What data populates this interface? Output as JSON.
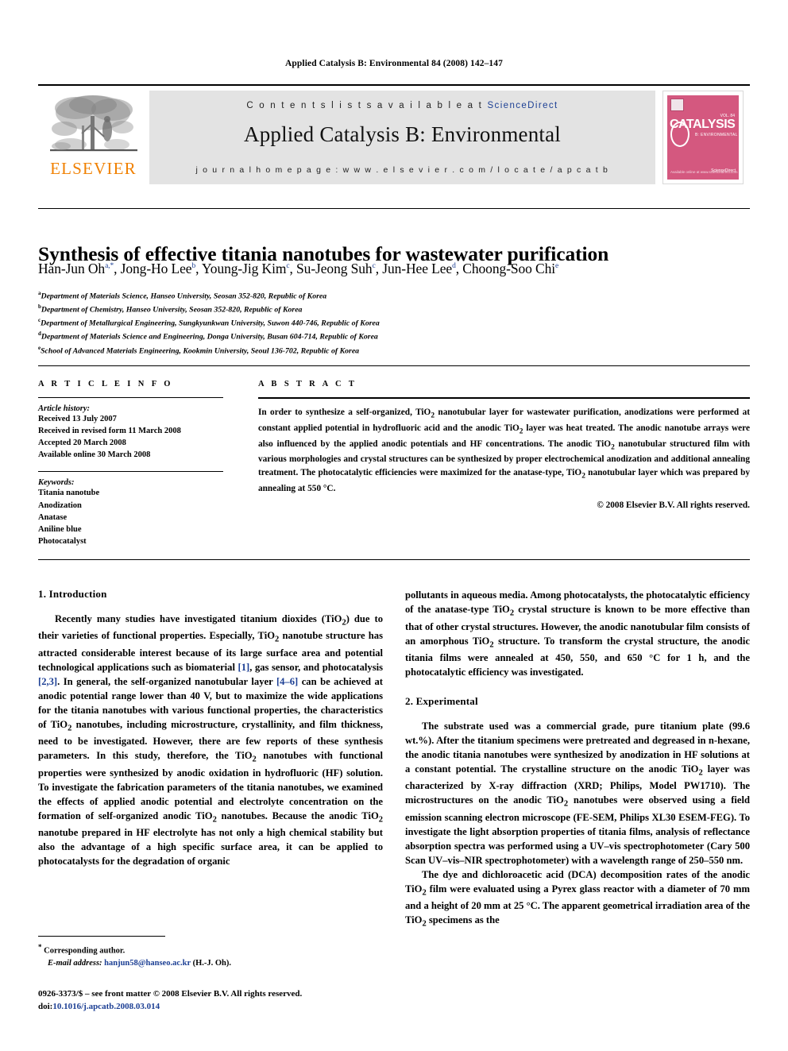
{
  "running_head": "Applied Catalysis B: Environmental 84 (2008) 142–147",
  "masthead": {
    "publisher_name": "ELSEVIER",
    "contents_prefix": "C o n t e n t s   l i s t s   a v a i l a b l e   a t  ",
    "contents_link": "ScienceDirect",
    "journal_name": "Applied Catalysis B: Environmental",
    "homepage": "j o u r n a l   h o m e p a g e :   w w w . e l s e v i e r . c o m / l o c a t e / a p c a t b",
    "cover": {
      "title": "CATALYSIS",
      "subtitle": "B: ENVIRONMENTAL",
      "volume": "VOL. 84",
      "footer_left": "Available online at\nwww.sciencedirect.com",
      "footer_right": "ScienceDirect",
      "bg_color": "#d4587f"
    }
  },
  "article": {
    "title": "Synthesis of effective titania nanotubes for wastewater purification",
    "authors": [
      {
        "name": "Han-Jun Oh",
        "marks": "a,*"
      },
      {
        "name": "Jong-Ho Lee",
        "marks": "b"
      },
      {
        "name": "Young-Jig Kim",
        "marks": "c"
      },
      {
        "name": "Su-Jeong Suh",
        "marks": "c"
      },
      {
        "name": "Jun-Hee Lee",
        "marks": "d"
      },
      {
        "name": "Choong-Soo Chi",
        "marks": "e"
      }
    ],
    "affiliations": [
      {
        "mark": "a",
        "text": "Department of Materials Science, Hanseo University, Seosan 352-820, Republic of Korea"
      },
      {
        "mark": "b",
        "text": "Department of Chemistry, Hanseo University, Seosan 352-820, Republic of Korea"
      },
      {
        "mark": "c",
        "text": "Department of Metallurgical Engineering, Sungkyunkwan University, Suwon 440-746, Republic of Korea"
      },
      {
        "mark": "d",
        "text": "Department of Materials Science and Engineering, Donga University, Busan 604-714, Republic of Korea"
      },
      {
        "mark": "e",
        "text": "School of Advanced Materials Engineering, Kookmin University, Seoul 136-702, Republic of Korea"
      }
    ]
  },
  "article_info": {
    "heading": "A R T I C L E   I N F O",
    "history_heading": "Article history:",
    "history": [
      "Received 13 July 2007",
      "Received in revised form 11 March 2008",
      "Accepted 20 March 2008",
      "Available online 30 March 2008"
    ],
    "keywords_heading": "Keywords:",
    "keywords": [
      "Titania nanotube",
      "Anodization",
      "Anatase",
      "Aniline blue",
      "Photocatalyst"
    ]
  },
  "abstract": {
    "heading": "A B S T R A C T",
    "text": "In order to synthesize a self-organized, TiO2 nanotubular layer for wastewater purification, anodizations were performed at constant applied potential in hydrofluoric acid and the anodic TiO2 layer was heat treated. The anodic nanotube arrays were also influenced by the applied anodic potentials and HF concentrations. The anodic TiO2 nanotubular structured film with various morphologies and crystal structures can be synthesized by proper electrochemical anodization and additional annealing treatment. The photocatalytic efficiencies were maximized for the anatase-type, TiO2 nanotubular layer which was prepared by annealing at 550 °C.",
    "copyright": "© 2008 Elsevier B.V. All rights reserved."
  },
  "sections": {
    "introduction_heading": "1. Introduction",
    "intro_p1_a": "Recently many studies have investigated titanium dioxides (TiO2) due to their varieties of functional properties. Especially, TiO2 nanotube structure has attracted considerable interest because of its large surface area and potential technological applications such as biomaterial ",
    "intro_ref1": "[1]",
    "intro_p1_b": ", gas sensor, and photocatalysis ",
    "intro_ref2": "[2,3]",
    "intro_p1_c": ". In general, the self-organized nanotubular layer ",
    "intro_ref3": "[4–6]",
    "intro_p1_d": " can be achieved at anodic potential range lower than 40 V, but to maximize the wide applications for the titania nanotubes with various functional properties, the characteristics of TiO2 nanotubes, including microstructure, crystallinity, and film thickness, need to be investigated. However, there are few reports of these synthesis parameters. In this study, therefore, the TiO2 nanotubes with functional properties were synthesized by anodic oxidation in hydrofluoric (HF) solution. To investigate the fabrication parameters of the titania nanotubes, we examined the effects of applied anodic potential and electrolyte concentration on the formation of self-organized anodic TiO2 nanotubes. Because the anodic TiO2 nanotube prepared in HF electrolyte has not only a high chemical stability but also the advantage of a high specific surface area, it can be applied to photocatalysts for the degradation of organic pollutants in aqueous media. Among photocatalysts, the photocatalytic efficiency of the anatase-type TiO2 crystal structure is known to be more effective than that of other crystal structures. However, the anodic nanotubular film consists of an amorphous TiO2 structure. To transform the crystal structure, the anodic titania films were annealed at 450, 550, and 650 °C for 1 h, and the photocatalytic efficiency was investigated.",
    "experimental_heading": "2. Experimental",
    "exp_p1": "The substrate used was a commercial grade, pure titanium plate (99.6 wt.%). After the titanium specimens were pretreated and degreased in n-hexane, the anodic titania nanotubes were synthesized by anodization in HF solutions at a constant potential. The crystalline structure on the anodic TiO2 layer was characterized by X-ray diffraction (XRD; Philips, Model PW1710). The microstructures on the anodic TiO2 nanotubes were observed using a field emission scanning electron microscope (FE-SEM, Philips XL30 ESEM-FEG). To investigate the light absorption properties of titania films, analysis of reflectance absorption spectra was performed using a UV–vis spectrophotometer (Cary 500 Scan UV–vis–NIR spectrophotometer) with a wavelength range of 250–550 nm.",
    "exp_p2": "The dye and dichloroacetic acid (DCA) decomposition rates of the anodic TiO2 film were evaluated using a Pyrex glass reactor with a diameter of 70 mm and a height of 20 mm at 25 °C. The apparent geometrical irradiation area of the TiO2 specimens as the"
  },
  "footnotes": {
    "corresponding_mark": "*",
    "corresponding_label": "Corresponding author.",
    "email_label": "E-mail address:",
    "email": "hanjun58@hanseo.ac.kr",
    "email_owner": "(H.-J. Oh).",
    "issn_line": "0926-3373/$ – see front matter © 2008 Elsevier B.V. All rights reserved.",
    "doi_prefix": "doi:",
    "doi": "10.1016/j.apcatb.2008.03.014"
  },
  "colors": {
    "link": "#1c3f94",
    "elsevier_orange": "#F08000",
    "band_gray": "#e3e3e3"
  }
}
